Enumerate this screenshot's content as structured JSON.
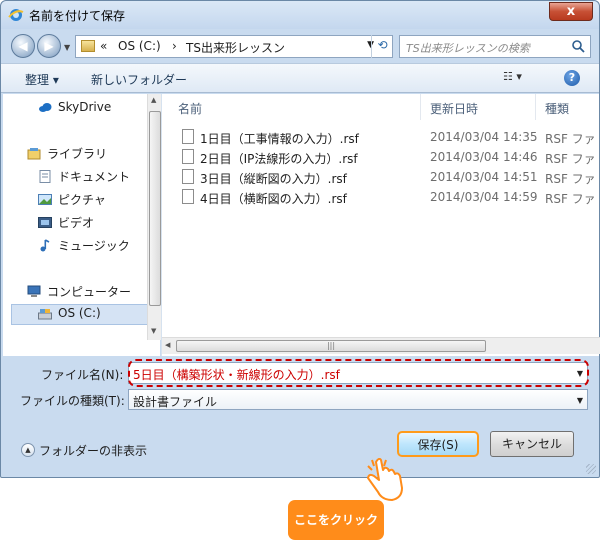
{
  "window": {
    "title": "名前を付けて保存",
    "close_label": "x"
  },
  "address": {
    "prefix": "«",
    "segment1": "OS (C:)",
    "separator": "›",
    "segment2": "TS出来形レッスン",
    "search_placeholder": "TS出来形レッスンの検索"
  },
  "toolbar": {
    "organize": "整理 ▾",
    "new_folder": "新しいフォルダー",
    "view": "☷ ▾",
    "help": "?"
  },
  "nav": {
    "items": [
      {
        "label": "SkyDrive",
        "icon": "skydrive-icon"
      },
      {
        "label": "ライブラリ",
        "icon": "library-icon"
      },
      {
        "label": "ドキュメント",
        "icon": "documents-icon"
      },
      {
        "label": "ピクチャ",
        "icon": "pictures-icon"
      },
      {
        "label": "ビデオ",
        "icon": "video-icon"
      },
      {
        "label": "ミュージック",
        "icon": "music-icon"
      },
      {
        "label": "コンピューター",
        "icon": "computer-icon"
      },
      {
        "label": "OS (C:)",
        "icon": "drive-icon"
      }
    ],
    "selected": "OS (C:)"
  },
  "columns": {
    "name": "名前",
    "date": "更新日時",
    "type": "種類"
  },
  "files": [
    {
      "name": "1日目（工事情報の入力）.rsf",
      "date": "2014/03/04 14:35",
      "type": "RSF ファ"
    },
    {
      "name": "2日目（IP法線形の入力）.rsf",
      "date": "2014/03/04 14:46",
      "type": "RSF ファ"
    },
    {
      "name": "3日目（縦断図の入力）.rsf",
      "date": "2014/03/04 14:51",
      "type": "RSF ファ"
    },
    {
      "name": "4日目（横断図の入力）.rsf",
      "date": "2014/03/04 14:59",
      "type": "RSF ファ"
    }
  ],
  "form": {
    "filename_label": "ファイル名(N):",
    "filename_value": "5日目（構築形状・新線形の入力）.rsf",
    "filetype_label": "ファイルの種類(T):",
    "filetype_value": "設計書ファイル"
  },
  "footer": {
    "hide_folders": "フォルダーの非表示",
    "save": "保存(S)",
    "cancel": "キャンセル"
  },
  "callout": {
    "text": "ここをクリック"
  },
  "colors": {
    "highlight": "#cc0000",
    "callout": "#ff8c1a"
  }
}
